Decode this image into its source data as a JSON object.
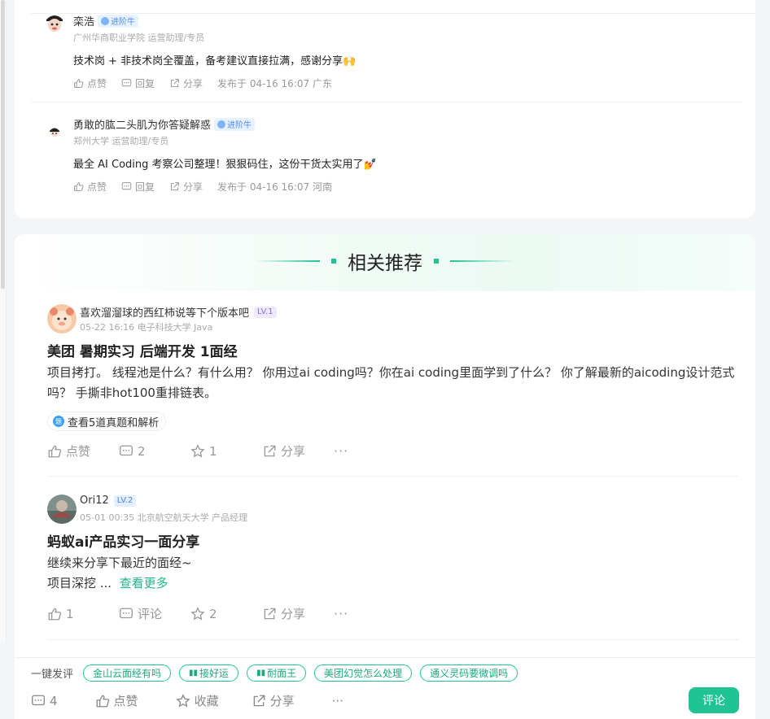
{
  "comments": [
    {
      "name": "栾浩",
      "badge": "进阶牛",
      "meta": "广州华商职业学院 运营助理/专员",
      "content": "技术岗 + 非技术岗全覆盖，备考建议直接拉满，感谢分享🙌",
      "like": "点赞",
      "reply": "回复",
      "share": "分享",
      "time": "发布于 04-16 16:07 广东"
    },
    {
      "name": "勇敢的肱二头肌为你答疑解惑",
      "badge": "进阶牛",
      "meta": "郑州大学 运营助理/专员",
      "content": "最全 AI Coding 考察公司整理！狠狠码住，这份干货太实用了💅",
      "like": "点赞",
      "reply": "回复",
      "share": "分享",
      "time": "发布于 04-16 16:07 河南"
    }
  ],
  "recommend": {
    "title": "相关推荐",
    "posts": [
      {
        "user": "喜欢溜溜球的西红柿说等下个版本吧",
        "level": "LV.1",
        "meta": "05-22 16:16   电子科技大学 Java",
        "title": "美团 暑期实习 后端开发 1面经",
        "body": "项目拷打。 线程池是什么？有什么用？ 你用过ai coding吗？你在ai coding里面学到了什么？ 你了解最新的aicoding设计范式吗？ 手撕非hot100重排链表。",
        "chip": "查看5道真题和解析",
        "like": "点赞",
        "comments": "2",
        "stars": "1",
        "share": "分享",
        "more": "···"
      },
      {
        "user": "Ori12",
        "level": "LV.2",
        "meta": "05-01 00:35   北京航空航天大学 产品经理",
        "title": "蚂蚁ai产品实习一面分享",
        "body_line1": "继续来分享下最近的面经~",
        "body_line2": "项目深挖 ...",
        "see_more": "查看更多",
        "likes": "1",
        "comment": "评论",
        "stars": "2",
        "share": "分享",
        "more": "···"
      }
    ]
  },
  "bottom": {
    "quick_label": "一键发评",
    "tags": [
      {
        "pre": "",
        "text": "金山云面经有吗"
      },
      {
        "pre": "▮▮",
        "text": "接好运"
      },
      {
        "pre": "▮▮",
        "text": "耐面王"
      },
      {
        "pre": "",
        "text": "美团幻觉怎么处理"
      },
      {
        "pre": "",
        "text": "通义灵码要微调吗"
      }
    ],
    "comment_count": "4",
    "like": "点赞",
    "collect": "收藏",
    "share": "分享",
    "more": "···",
    "submit": "评论"
  },
  "colors": {
    "accent": "#20c494",
    "badge_bg": "#e8f2ff"
  }
}
